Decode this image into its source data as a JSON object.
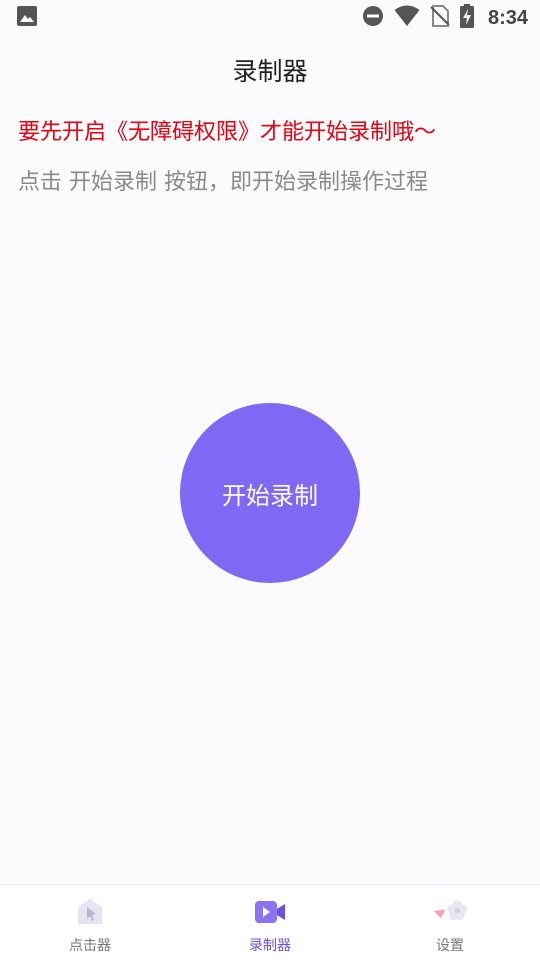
{
  "status_bar": {
    "time": "8:34",
    "icons": [
      "image-icon",
      "dnd-icon",
      "wifi-icon",
      "no-sim-icon",
      "battery-charging-icon"
    ]
  },
  "header": {
    "title": "录制器"
  },
  "main": {
    "warning": "要先开启《无障碍权限》才能开始录制哦～",
    "hint": "点击 开始录制 按钮，即开始录制操作过程",
    "record_button_label": "开始录制"
  },
  "tabs": [
    {
      "label": "点击器",
      "icon": "clicker-icon",
      "active": false
    },
    {
      "label": "录制器",
      "icon": "video-recorder-icon",
      "active": true
    },
    {
      "label": "设置",
      "icon": "settings-flower-icon",
      "active": false
    }
  ],
  "colors": {
    "accent": "#7f68f4",
    "warning": "#e60012",
    "hint": "#8a8a8a",
    "background": "#fbfbfe"
  }
}
